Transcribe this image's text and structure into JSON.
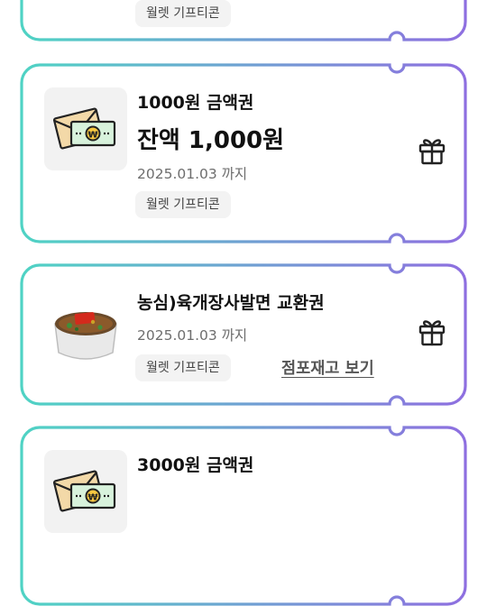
{
  "colors": {
    "border_left": "#4fd3c4",
    "border_right": "#8e6fe0",
    "tag_bg": "#f3f3f3",
    "thumb_bg": "#f2f2f2"
  },
  "cards": [
    {
      "tag": "월렛 기프티콘",
      "action_icon": "gift-icon"
    },
    {
      "thumbnail_icon": "money-envelope-icon",
      "title": "1000원 금액권",
      "balance": "잔액 1,000원",
      "expiry": "2025.01.03 까지",
      "tag": "월렛 기프티콘",
      "action_icon": "gift-icon"
    },
    {
      "thumbnail_icon": "ramen-cup-icon",
      "title": "농심)육개장사발면 교환권",
      "expiry": "2025.01.03 까지",
      "tag": "월렛 기프티콘",
      "link": "점포재고 보기",
      "action_icon": "gift-icon"
    },
    {
      "thumbnail_icon": "money-envelope-icon",
      "title": "3000원 금액권",
      "action_icon": "gift-icon"
    }
  ]
}
